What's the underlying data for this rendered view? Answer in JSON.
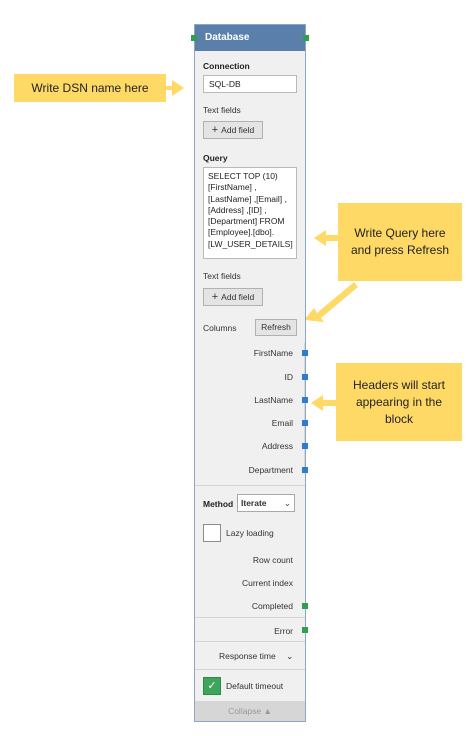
{
  "block": {
    "title": "Database",
    "connection_label": "Connection",
    "connection_value": "SQL-DB",
    "text_fields_label": "Text fields",
    "add_field_label": "Add field",
    "query_label": "Query",
    "query_value": "SELECT TOP (10)\n[FirstName] ,\n[LastName] ,[Email] ,\n[Address] ,[ID] ,\n[Department] FROM\n[Employee].[dbo].\n[LW_USER_DETAILS]",
    "text_fields_label_2": "Text fields",
    "add_field_label_2": "Add field",
    "columns_label": "Columns",
    "refresh_label": "Refresh",
    "columns": [
      "FirstName",
      "ID",
      "LastName",
      "Email",
      "Address",
      "Department"
    ],
    "method_label": "Method",
    "method_value": "Iterate",
    "lazy_loading_label": "Lazy loading",
    "row_count_label": "Row count",
    "current_index_label": "Current index",
    "completed_label": "Completed",
    "error_label": "Error",
    "response_time_label": "Response time",
    "default_timeout_label": "Default timeout",
    "collapse_label": "Collapse"
  },
  "callouts": {
    "dsn": "Write DSN name here",
    "query": "Write Query here and press Refresh",
    "headers": "Headers will start appearing in the block"
  },
  "colors": {
    "header": "#5b7fab",
    "callout": "#ffd966",
    "port_green": "#2e9f4e",
    "port_blue": "#2f7bd0"
  }
}
